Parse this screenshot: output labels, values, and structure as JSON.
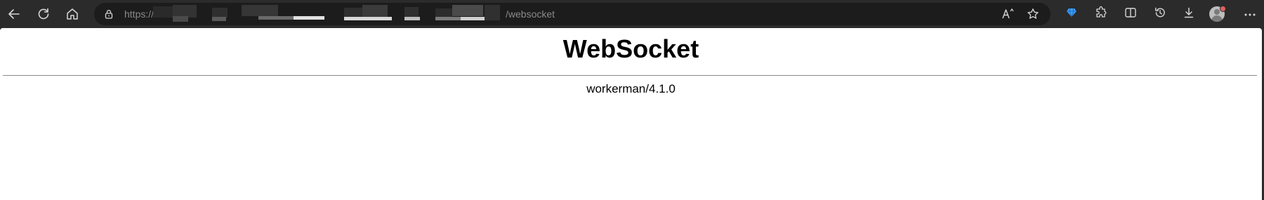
{
  "browser": {
    "address_bar": {
      "url_scheme": "https://",
      "url_path": "/websocket",
      "url_host_redacted": true
    },
    "icons": {
      "back": "back-arrow-icon",
      "refresh": "refresh-icon",
      "home": "home-icon",
      "lock": "lock-icon",
      "read_aloud": "read-aloud-icon",
      "favorite": "favorite-star-icon",
      "extension_gem": "gem-extension-icon",
      "extensions": "extensions-puzzle-icon",
      "split_screen": "split-screen-icon",
      "history": "history-icon",
      "downloads": "downloads-icon",
      "profile": "profile-avatar",
      "more": "more-menu-icon"
    },
    "colors": {
      "toolbar_bg": "#2b2b2b",
      "address_bg": "#1c1c1c",
      "icon": "#d6d6d6",
      "gem_accent": "#3aa0ff",
      "avatar_badge": "#e06060"
    }
  },
  "page": {
    "heading": "WebSocket",
    "signature": "workerman/4.1.0",
    "colors": {
      "background": "#ffffff",
      "text": "#000000",
      "rule": "#8a8a8a"
    }
  }
}
